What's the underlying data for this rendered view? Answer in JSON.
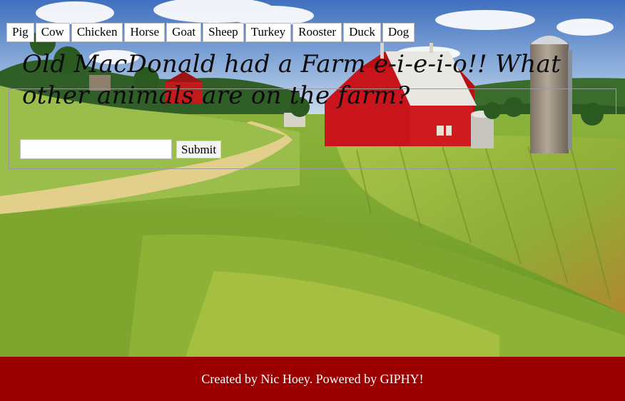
{
  "animal_buttons": [
    "Pig",
    "Cow",
    "Chicken",
    "Horse",
    "Goat",
    "Sheep",
    "Turkey",
    "Rooster",
    "Duck",
    "Dog"
  ],
  "heading": "Old MacDonald had a Farm e-i-e-i-o!! What other animals are on the farm?",
  "search": {
    "value": "",
    "placeholder": ""
  },
  "submit_label": "Submit",
  "footer_text": "Created by Nic Hoey. Powered by GIPHY!",
  "colors": {
    "footer_bg": "#9a0000",
    "footer_text": "#ffffff",
    "barn_red": "#c8141a",
    "sky": "#4b78c2",
    "field_green": "#86b33a"
  }
}
